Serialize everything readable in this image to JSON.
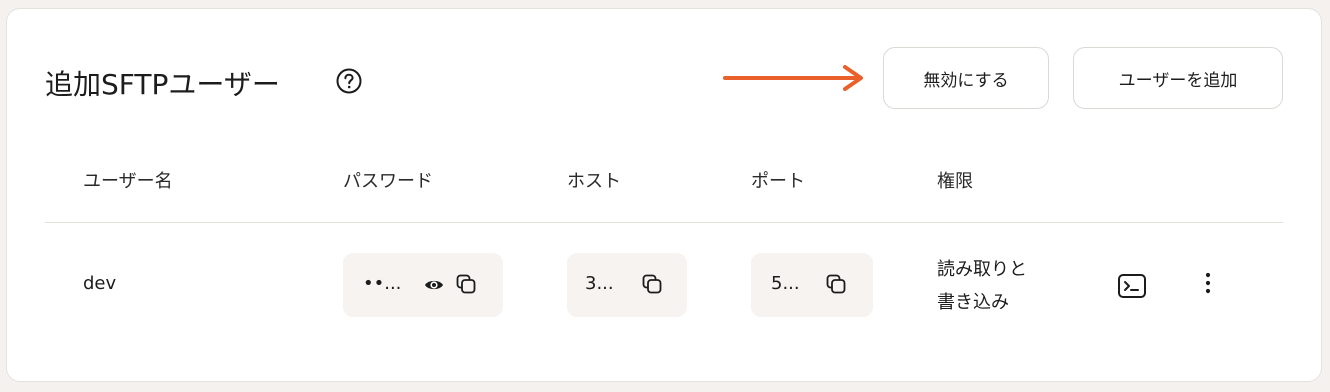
{
  "header": {
    "title": "追加SFTPユーザー",
    "help_icon": "question-circle-icon",
    "arrow_color": "#e9602b",
    "disable_button": "無効にする",
    "add_user_button": "ユーザーを追加"
  },
  "table": {
    "columns": [
      "ユーザー名",
      "パスワード",
      "ホスト",
      "ポート",
      "権限"
    ],
    "rows": [
      {
        "username": "dev",
        "password_masked": "••...",
        "host": "3...",
        "port": "5...",
        "permission_line1": "読み取りと",
        "permission_line2": "書き込み"
      }
    ]
  },
  "icons": {
    "show_password": "eye-icon",
    "copy": "copy-icon",
    "terminal": "terminal-icon",
    "more": "more-vertical-icon"
  }
}
